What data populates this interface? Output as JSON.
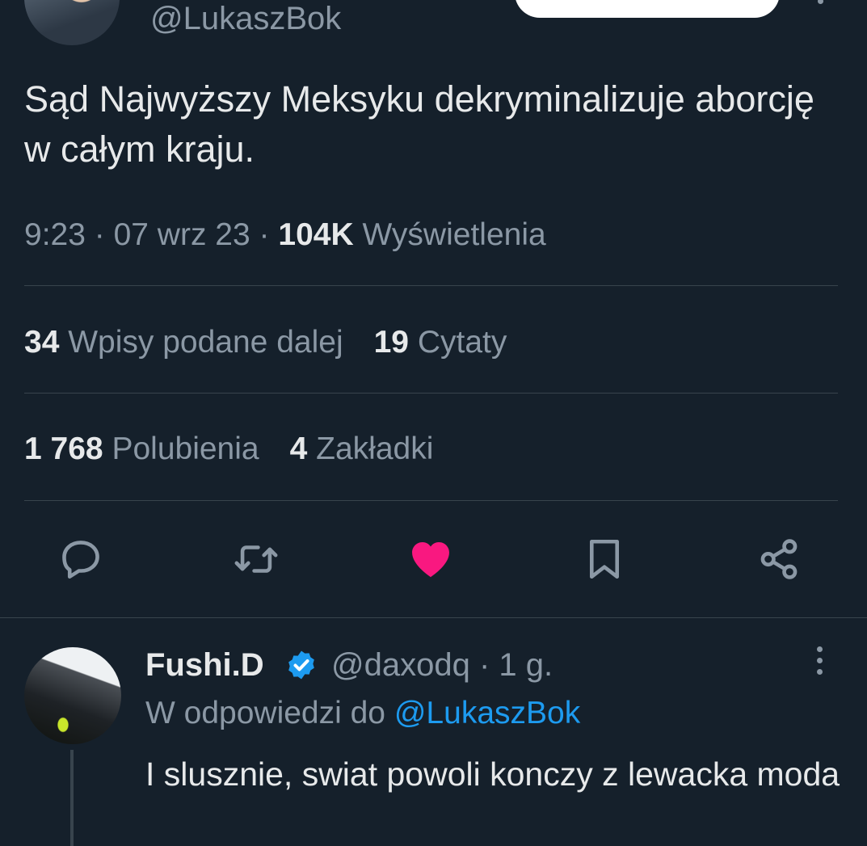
{
  "tweet": {
    "handle": "@LukaszBok",
    "text": "Sąd Najwyższy Meksyku dekryminalizuje aborcję w całym kraju.",
    "time": "9:23",
    "date": "07 wrz 23",
    "views_count": "104K",
    "views_label": "Wyświetlenia",
    "separator": "·"
  },
  "stats": {
    "retweets_count": "34",
    "retweets_label": "Wpisy podane dalej",
    "quotes_count": "19",
    "quotes_label": "Cytaty",
    "likes_count": "1 768",
    "likes_label": "Polubienia",
    "bookmarks_count": "4",
    "bookmarks_label": "Zakładki"
  },
  "actions": {
    "icons": [
      "reply-icon",
      "retweet-icon",
      "like-icon",
      "bookmark-icon",
      "share-icon"
    ],
    "liked": true
  },
  "reply": {
    "name": "Fushi.D",
    "handle": "@daxodq",
    "age": "1 g.",
    "separator": "·",
    "reply_to_prefix": "W odpowiedzi do",
    "reply_to_handle": "@LukaszBok",
    "text": "I slusznie, swiat powoli konczy z lewacka moda"
  },
  "colors": {
    "background": "#15202b",
    "text": "#e7e9ea",
    "muted": "#8b98a5",
    "divider": "#38444d",
    "accent": "#1d9bf0",
    "like": "#f91880"
  }
}
